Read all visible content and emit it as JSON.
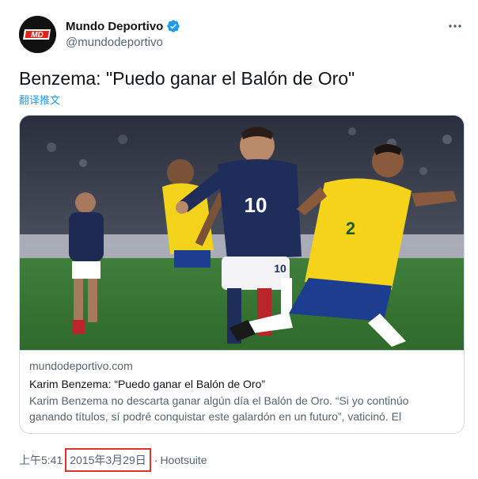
{
  "account": {
    "display_name": "Mundo Deportivo",
    "handle": "@mundodeportivo",
    "avatar_text": "MD",
    "verified": true
  },
  "tweet": {
    "text": "Benzema: \"Puedo ganar el Balón de Oro\"",
    "translate_label": "翻译推文"
  },
  "card": {
    "domain": "mundodeportivo.com",
    "title": "Karim Benzema: “Puedo ganar el Balón de Oro”",
    "description_line1": "Karim Benzema no descarta ganar algún día el Balón de Oro. “Si yo continúo",
    "description_line2": "ganando títulos, sí podré conquistar este galardón en un futuro”, vaticinó. El",
    "image_alt": "football-match-photo",
    "jersey_numbers": [
      "10",
      "2"
    ]
  },
  "meta": {
    "time": "上午5:41",
    "date": "2015年3月29日",
    "separator": "·",
    "source": "Hootsuite"
  },
  "colors": {
    "link": "#1d9bf0",
    "secondary_text": "#536471",
    "highlight_box": "#e0322d",
    "brand_red": "#e2231a"
  },
  "icons": {
    "verified": "verified-badge-icon",
    "more": "more-options-icon"
  }
}
